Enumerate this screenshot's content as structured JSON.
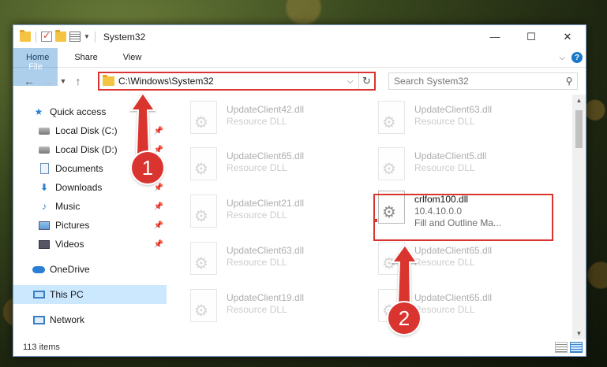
{
  "window": {
    "title": "System32",
    "controls": {
      "minimize": "—",
      "maximize": "☐",
      "close": "✕"
    }
  },
  "ribbon": {
    "tabs": [
      "File",
      "Home",
      "Share",
      "View"
    ],
    "expand_icon": "⌵",
    "help_label": "?"
  },
  "address": {
    "path": "C:\\Windows\\System32",
    "search_placeholder": "Search System32"
  },
  "sidebar": {
    "items": [
      {
        "label": "Quick access",
        "icon": "star-icon",
        "pinned": false
      },
      {
        "label": "Local Disk (C:)",
        "icon": "disk-icon",
        "pinned": true
      },
      {
        "label": "Local Disk (D:)",
        "icon": "disk-icon",
        "pinned": true
      },
      {
        "label": "Documents",
        "icon": "documents-icon",
        "pinned": true
      },
      {
        "label": "Downloads",
        "icon": "downloads-icon",
        "pinned": true
      },
      {
        "label": "Music",
        "icon": "music-icon",
        "pinned": true
      },
      {
        "label": "Pictures",
        "icon": "pictures-icon",
        "pinned": true
      },
      {
        "label": "Videos",
        "icon": "videos-icon",
        "pinned": true
      },
      {
        "label": "OneDrive",
        "icon": "onedrive-icon",
        "pinned": false
      },
      {
        "label": "This PC",
        "icon": "this-pc-icon",
        "pinned": false,
        "selected": true
      },
      {
        "label": "Network",
        "icon": "network-icon",
        "pinned": false
      }
    ]
  },
  "files": [
    {
      "name": "UpdateClient42.dll",
      "type": "Resource DLL"
    },
    {
      "name": "UpdateClient63.dll",
      "type": "Resource DLL"
    },
    {
      "name": "UpdateClient65.dll",
      "type": "Resource DLL"
    },
    {
      "name": "UpdateClient5.dll",
      "type": "Resource DLL"
    },
    {
      "name": "UpdateClient21.dll",
      "type": "Resource DLL"
    },
    {
      "name": "crlfom100.dll",
      "version": "10.4.10.0.0",
      "type": "Fill and Outline Ma...",
      "highlighted": true
    },
    {
      "name": "UpdateClient63.dll",
      "type": "Resource DLL"
    },
    {
      "name": "UpdateClient65.dll",
      "type": "Resource DLL"
    },
    {
      "name": "UpdateClient19.dll",
      "type": "Resource DLL"
    },
    {
      "name": "UpdateClient65.dll",
      "type": "Resource DLL"
    }
  ],
  "status": {
    "item_count": "113 items"
  },
  "callouts": {
    "step1": "1",
    "step2": "2"
  },
  "colors": {
    "accent": "#1979ca",
    "callout_red": "#d9342f",
    "selected_bg": "#cce8ff"
  }
}
